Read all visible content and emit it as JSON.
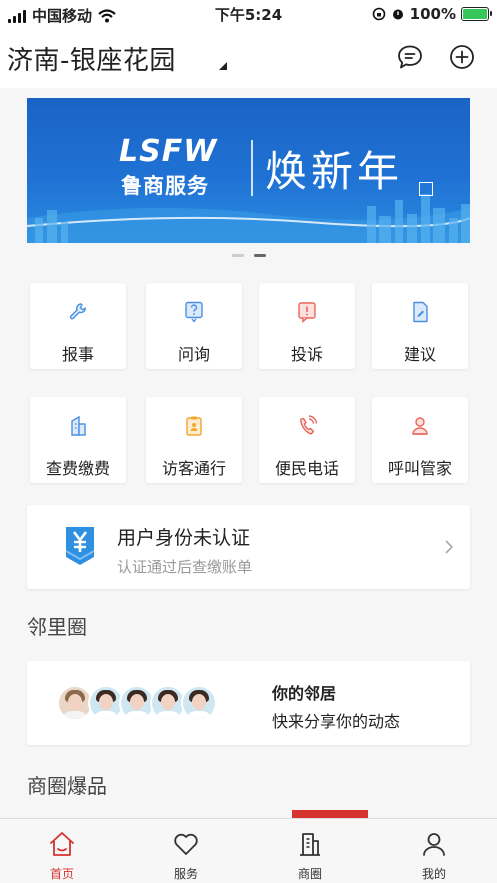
{
  "status_bar": {
    "carrier": "中国移动",
    "time": "下午5:24",
    "battery_percent": "100%",
    "battery_level": 1.0
  },
  "header": {
    "community_name": "济南-银座花园"
  },
  "banner": {
    "logo_text": "LSFW",
    "brand_text": "鲁商服务",
    "slogan": "焕新年",
    "slide_count": 2,
    "active_slide": 2
  },
  "services_row1": [
    {
      "label": "报事",
      "icon": "wrench-icon",
      "color": "#4a90e2"
    },
    {
      "label": "问询",
      "icon": "question-doc-icon",
      "color": "#4a90e2"
    },
    {
      "label": "投诉",
      "icon": "complaint-icon",
      "color": "#e9655a"
    },
    {
      "label": "建议",
      "icon": "suggestion-doc-icon",
      "color": "#4a90e2"
    }
  ],
  "services_row2": [
    {
      "label": "查费缴费",
      "icon": "building-bill-icon",
      "color": "#4a90e2"
    },
    {
      "label": "访客通行",
      "icon": "visitor-pass-icon",
      "color": "#f0a830"
    },
    {
      "label": "便民电话",
      "icon": "phone-icon",
      "color": "#e9655a"
    },
    {
      "label": "呼叫管家",
      "icon": "butler-icon",
      "color": "#e9655a"
    }
  ],
  "auth_card": {
    "title": "用户身份未认证",
    "subtitle": "认证通过后查缴账单",
    "icon": "yuan-icon",
    "icon_color": "#2f8fe0"
  },
  "neighbors_section": {
    "title": "邻里圈",
    "card_title": "你的邻居",
    "card_subtitle": "快来分享你的动态",
    "avatar_count": 5
  },
  "shop_section": {
    "title": "商圈爆品"
  },
  "tab_bar": {
    "tabs": [
      {
        "label": "首页",
        "icon": "home-icon",
        "active": true
      },
      {
        "label": "服务",
        "icon": "heart-icon",
        "active": false
      },
      {
        "label": "商圈",
        "icon": "building-icon",
        "active": false
      },
      {
        "label": "我的",
        "icon": "user-icon",
        "active": false
      }
    ],
    "active_color": "#d5322f"
  }
}
